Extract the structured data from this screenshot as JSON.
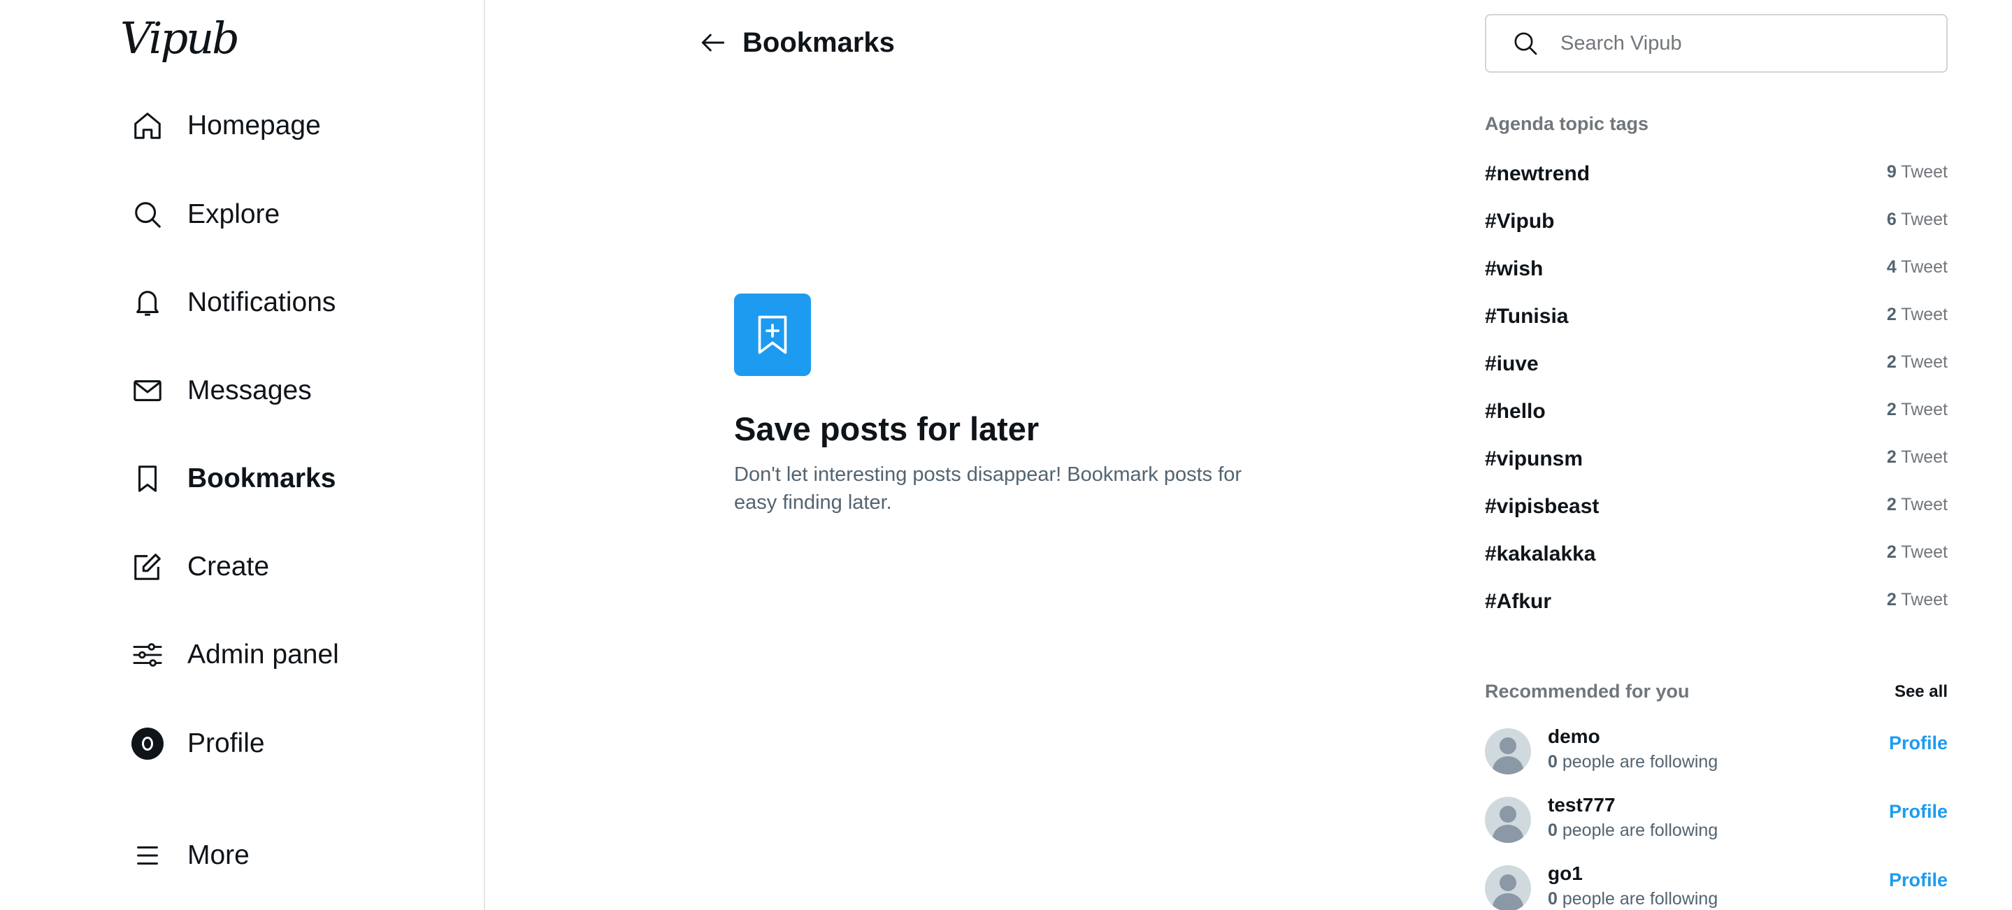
{
  "app": {
    "logo": "Vipub"
  },
  "sidebar": {
    "items": [
      {
        "label": "Homepage",
        "icon": "home-icon"
      },
      {
        "label": "Explore",
        "icon": "search-icon"
      },
      {
        "label": "Notifications",
        "icon": "bell-icon"
      },
      {
        "label": "Messages",
        "icon": "envelope-icon"
      },
      {
        "label": "Bookmarks",
        "icon": "bookmark-icon",
        "active": true
      },
      {
        "label": "Create",
        "icon": "edit-icon"
      },
      {
        "label": "Admin panel",
        "icon": "sliders-icon"
      },
      {
        "label": "Profile",
        "icon": "avatar-icon"
      },
      {
        "label": "More",
        "icon": "menu-icon"
      }
    ]
  },
  "header": {
    "title": "Bookmarks"
  },
  "empty_state": {
    "title": "Save posts for later",
    "description": "Don't let interesting posts disappear! Bookmark posts for easy finding later."
  },
  "search": {
    "placeholder": "Search Vipub"
  },
  "tags": {
    "title": "Agenda topic tags",
    "unit": "Tweet",
    "items": [
      {
        "name": "#newtrend",
        "count": "9"
      },
      {
        "name": "#Vipub",
        "count": "6"
      },
      {
        "name": "#wish",
        "count": "4"
      },
      {
        "name": "#Tunisia",
        "count": "2"
      },
      {
        "name": "#iuve",
        "count": "2"
      },
      {
        "name": "#hello",
        "count": "2"
      },
      {
        "name": "#vipunsm",
        "count": "2"
      },
      {
        "name": "#vipisbeast",
        "count": "2"
      },
      {
        "name": "#kakalakka",
        "count": "2"
      },
      {
        "name": "#Afkur",
        "count": "2"
      }
    ]
  },
  "recommended": {
    "title": "Recommended for you",
    "see_all": "See all",
    "following_text": "people are following",
    "link_label": "Profile",
    "users": [
      {
        "name": "demo",
        "following": "0"
      },
      {
        "name": "test777",
        "following": "0"
      },
      {
        "name": "go1",
        "following": "0"
      }
    ]
  },
  "colors": {
    "accent": "#1d9bf0",
    "text": "#0f1419",
    "muted": "#536471"
  }
}
